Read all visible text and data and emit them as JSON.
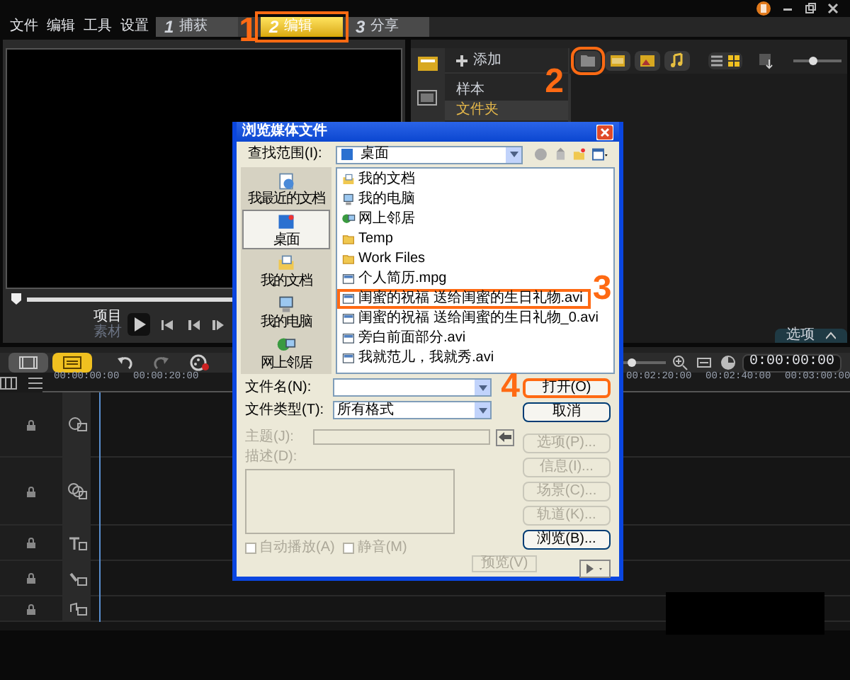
{
  "menu": [
    "文件",
    "编辑",
    "工具",
    "设置"
  ],
  "steps": [
    {
      "number": "1",
      "label": "捕获",
      "selected": false,
      "highlighted": false
    },
    {
      "number": "2",
      "label": "编辑",
      "selected": true,
      "highlighted": true
    },
    {
      "number": "3",
      "label": "分享",
      "selected": false,
      "highlighted": false
    }
  ],
  "preview": {
    "modes": [
      {
        "label": "项目",
        "selected": true
      },
      {
        "label": "素材",
        "selected": false
      }
    ]
  },
  "library": {
    "add": "添加",
    "categories": [
      {
        "label": "样本",
        "selected": false
      },
      {
        "label": "文件夹",
        "selected": true
      }
    ],
    "media_filters": [
      {
        "kind": "folder",
        "highlighted": true
      },
      {
        "kind": "video",
        "highlighted": false
      },
      {
        "kind": "photo",
        "highlighted": false
      },
      {
        "kind": "audio",
        "highlighted": false
      }
    ],
    "views": [
      {
        "kind": "list",
        "selected": false
      },
      {
        "kind": "thumbnail",
        "selected": true
      }
    ],
    "size_slider": {
      "level": 0.4
    },
    "options": "选项"
  },
  "timeline": {
    "views": [
      {
        "kind": "storyboard",
        "selected": false
      },
      {
        "kind": "timeline",
        "selected": true
      }
    ],
    "ruler": [
      "00:00:00:00",
      "00:00:20:00",
      "00:02:20:00",
      "00:02:40:00",
      "00:03:00:00"
    ],
    "timecode": "0:00:00:00",
    "zoom_slider": {
      "level": 0.2
    },
    "tracks": [
      {
        "kind": "video"
      },
      {
        "kind": "overlay"
      },
      {
        "kind": "title"
      },
      {
        "kind": "voice"
      },
      {
        "kind": "music"
      }
    ]
  },
  "dialog": {
    "title": "浏览媒体文件",
    "look_in_label": "查找范围(I):",
    "look_in": "桌面",
    "places": [
      {
        "label": "我最近的文档",
        "kind": "recent",
        "selected": false
      },
      {
        "label": "桌面",
        "kind": "desktop",
        "selected": true
      },
      {
        "label": "我的文档",
        "kind": "documents",
        "selected": false
      },
      {
        "label": "我的电脑",
        "kind": "computer",
        "selected": false
      },
      {
        "label": "网上邻居",
        "kind": "network",
        "selected": false
      }
    ],
    "files": [
      {
        "name": "我的文档",
        "kind": "documents",
        "highlighted": false
      },
      {
        "name": "我的电脑",
        "kind": "computer",
        "highlighted": false
      },
      {
        "name": "网上邻居",
        "kind": "network",
        "highlighted": false
      },
      {
        "name": "Temp",
        "kind": "folder",
        "highlighted": false
      },
      {
        "name": "Work Files",
        "kind": "folder",
        "highlighted": false
      },
      {
        "name": "个人简历.mpg",
        "kind": "video",
        "highlighted": false
      },
      {
        "name": "闺蜜的祝福 送给闺蜜的生日礼物.avi",
        "kind": "video",
        "highlighted": true
      },
      {
        "name": "闺蜜的祝福 送给闺蜜的生日礼物_0.avi",
        "kind": "video",
        "highlighted": false
      },
      {
        "name": "旁白前面部分.avi",
        "kind": "video",
        "highlighted": false
      },
      {
        "name": "我就范儿，我就秀.avi",
        "kind": "video",
        "highlighted": false
      }
    ],
    "file_name_label": "文件名(N):",
    "file_type_label": "文件类型(T):",
    "file_type": "所有格式",
    "subject_label": "主题(J):",
    "description_label": "描述(D):",
    "buttons": [
      {
        "label": "打开(O)",
        "disabled": false,
        "highlighted": true
      },
      {
        "label": "取消",
        "disabled": false,
        "highlighted": false
      }
    ],
    "side_buttons": [
      {
        "label": "选项(P)...",
        "disabled": true
      },
      {
        "label": "信息(I)...",
        "disabled": true
      },
      {
        "label": "场景(C)...",
        "disabled": true
      },
      {
        "label": "轨道(K)...",
        "disabled": true
      },
      {
        "label": "浏览(B)...",
        "disabled": false
      }
    ],
    "checkboxes": [
      {
        "label": "自动播放(A)",
        "checked": false,
        "disabled": true
      },
      {
        "label": "静音(M)",
        "checked": false,
        "disabled": true
      }
    ],
    "preview_button": {
      "label": "预览(V)",
      "disabled": true
    }
  },
  "callouts": [
    "1",
    "2",
    "3",
    "4"
  ]
}
